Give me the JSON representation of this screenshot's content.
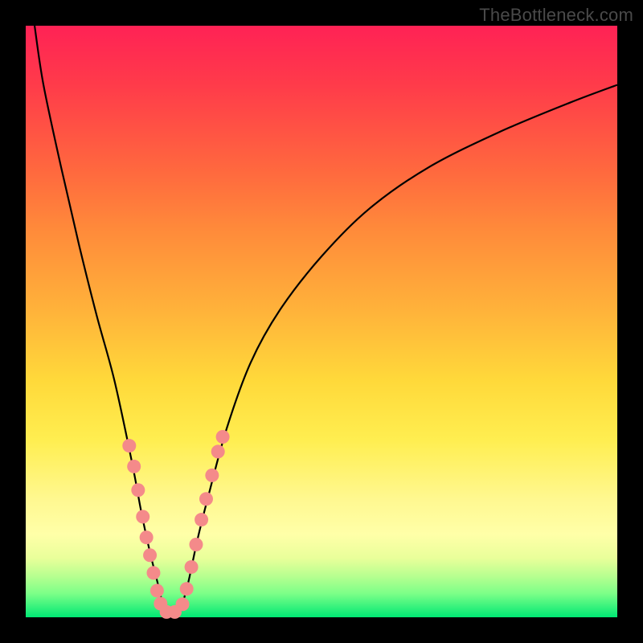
{
  "attribution": "TheBottleneck.com",
  "colors": {
    "frame": "#000000",
    "curve": "#000000",
    "marker": "#f48a8a",
    "gradient_top": "#ff2255",
    "gradient_bottom": "#00e874"
  },
  "chart_data": {
    "type": "line",
    "title": "",
    "xlabel": "",
    "ylabel": "",
    "xlim": [
      0,
      100
    ],
    "ylim": [
      0,
      100
    ],
    "note": "No axis ticks or numeric labels are shown in the image; values are estimated from pixel positions. y=0 is the bottom (green) edge; y=100 is the top (red) edge.",
    "series": [
      {
        "name": "left-branch",
        "x": [
          1.5,
          3,
          6,
          9,
          12,
          15,
          18,
          19.5,
          21,
          22.5,
          23.5
        ],
        "y": [
          100,
          90,
          76,
          63,
          51,
          40,
          26,
          18,
          11,
          5,
          0.5
        ]
      },
      {
        "name": "right-branch",
        "x": [
          26,
          27.5,
          29,
          31,
          34,
          38,
          43,
          50,
          58,
          68,
          80,
          92,
          100
        ],
        "y": [
          0.5,
          6,
          13,
          21,
          32,
          43,
          52,
          61,
          69,
          76,
          82,
          87,
          90
        ]
      }
    ],
    "markers": {
      "name": "highlighted-points",
      "note": "Salmon dots clustered near the valley on both branches",
      "points": [
        {
          "x": 17.5,
          "y": 29
        },
        {
          "x": 18.3,
          "y": 25.5
        },
        {
          "x": 19.0,
          "y": 21.5
        },
        {
          "x": 19.8,
          "y": 17
        },
        {
          "x": 20.4,
          "y": 13.5
        },
        {
          "x": 21.0,
          "y": 10.5
        },
        {
          "x": 21.6,
          "y": 7.5
        },
        {
          "x": 22.2,
          "y": 4.5
        },
        {
          "x": 22.8,
          "y": 2.3
        },
        {
          "x": 23.8,
          "y": 0.9
        },
        {
          "x": 25.2,
          "y": 0.9
        },
        {
          "x": 26.5,
          "y": 2.2
        },
        {
          "x": 27.2,
          "y": 4.8
        },
        {
          "x": 28.0,
          "y": 8.5
        },
        {
          "x": 28.8,
          "y": 12.3
        },
        {
          "x": 29.7,
          "y": 16.5
        },
        {
          "x": 30.5,
          "y": 20
        },
        {
          "x": 31.5,
          "y": 24
        },
        {
          "x": 32.5,
          "y": 28
        },
        {
          "x": 33.3,
          "y": 30.5
        }
      ]
    }
  }
}
